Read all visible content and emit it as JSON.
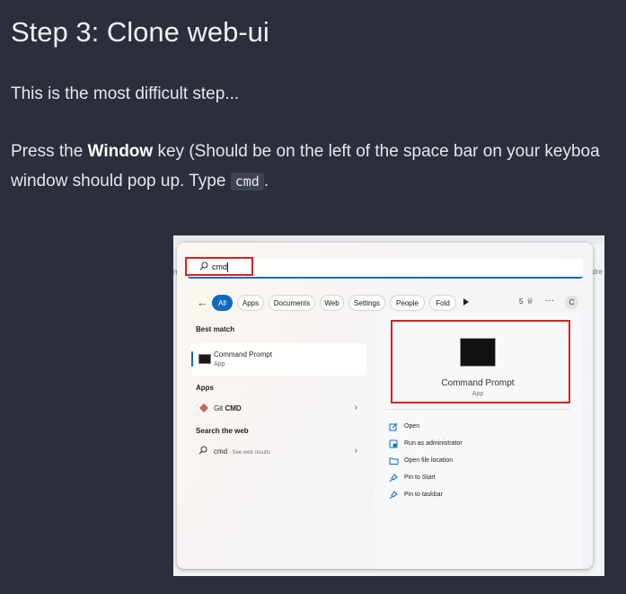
{
  "heading": "Step 3: Clone web-ui",
  "intro": "This is the most difficult step...",
  "instruction": {
    "press": "Press the ",
    "key": "Window",
    "rest_line1": " key (Should be on the left of the space bar on your keyboa",
    "line2_before": "window should pop up. Type ",
    "code": "cmd",
    "line2_after": "."
  },
  "screenshot": {
    "edge_left": "n",
    "edge_right": "dre",
    "search": {
      "value": "cmd"
    },
    "filters": [
      "All",
      "Apps",
      "Documents",
      "Web",
      "Settings",
      "People",
      "Fold"
    ],
    "active_filter": "All",
    "reward_count": "5",
    "avatar_letter": "C",
    "best_match": {
      "heading": "Best match",
      "title": "Command Prompt",
      "subtitle": "App"
    },
    "apps": {
      "heading": "Apps",
      "item_prefix": "Git ",
      "item_bold": "CMD"
    },
    "web": {
      "heading": "Search the web",
      "query": "cmd",
      "hint": " - See web results"
    },
    "detail": {
      "title": "Command Prompt",
      "subtitle": "App",
      "actions": [
        "Open",
        "Run as administrator",
        "Open file location",
        "Pin to Start",
        "Pin to taskbar"
      ]
    },
    "colors": {
      "accent": "#0f6cbd",
      "highlight": "#e02020"
    }
  }
}
